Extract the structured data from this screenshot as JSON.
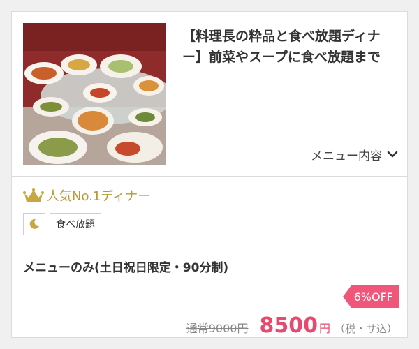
{
  "plan_card": {
    "title": "【料理長の粋品と食べ放題ディナー】前菜やスープに食べ放題まで",
    "menu_link_label": "メニュー内容",
    "rank_label": "人気No.1ディナー",
    "tags": [
      {
        "icon": "moon-icon",
        "label": ""
      },
      {
        "label": "食べ放題"
      }
    ],
    "plan_name": "メニューのみ(土日祝日限定・90分制)",
    "discount_label": "6%OFF",
    "regular_price": "通常9000円",
    "price": "8500",
    "price_unit": "円",
    "tax_note": "（税・サ込）"
  },
  "colors": {
    "accent_pink": "#e8496f",
    "discount_bg": "#f0557a",
    "gold": "#b99838",
    "text_dark": "#333333",
    "text_muted": "#888888",
    "border": "#dcdcdc"
  }
}
